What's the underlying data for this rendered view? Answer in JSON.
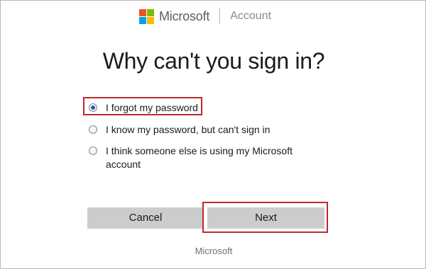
{
  "header": {
    "brand": "Microsoft",
    "section": "Account",
    "logo_colors": [
      "#f25022",
      "#7fba00",
      "#00a4ef",
      "#ffb900"
    ]
  },
  "title": "Why can't you sign in?",
  "options": [
    {
      "label": "I forgot my password",
      "selected": true
    },
    {
      "label": "I know my password, but can't sign in",
      "selected": false
    },
    {
      "label": "I think someone else is using my Microsoft account",
      "selected": false
    }
  ],
  "buttons": {
    "cancel_label": "Cancel",
    "next_label": "Next"
  },
  "footer": {
    "text": "Microsoft"
  },
  "colors": {
    "highlight": "#c0282e",
    "button_bg": "#cccccc",
    "radio_selected": "#1f5fbf"
  }
}
